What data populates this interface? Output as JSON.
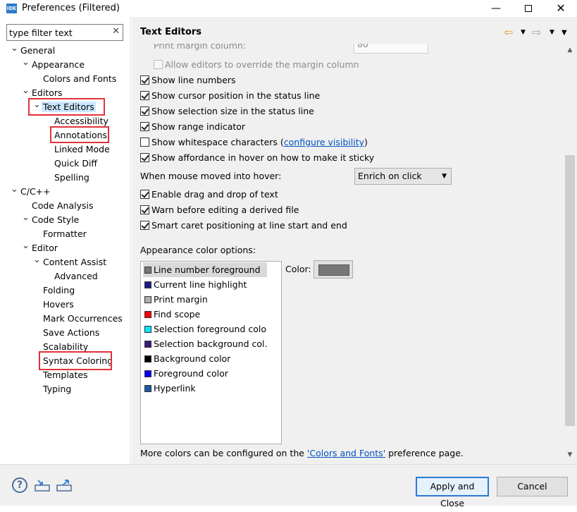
{
  "window": {
    "icon_text": "IDE",
    "title": "Preferences (Filtered)",
    "minimize": "—",
    "close": "✕"
  },
  "sidebar": {
    "filter_placeholder": "type filter text",
    "filter_value": "type filter text",
    "clear": "✕",
    "tree": [
      {
        "label": "General",
        "level": 0,
        "caret": "down"
      },
      {
        "label": "Appearance",
        "level": 1,
        "caret": "down"
      },
      {
        "label": "Colors and Fonts",
        "level": 2,
        "caret": "none"
      },
      {
        "label": "Editors",
        "level": 1,
        "caret": "down"
      },
      {
        "label": "Text Editors",
        "level": 2,
        "caret": "down",
        "selected": true
      },
      {
        "label": "Accessibility",
        "level": 3,
        "caret": "none"
      },
      {
        "label": "Annotations",
        "level": 3,
        "caret": "none"
      },
      {
        "label": "Linked Mode",
        "level": 3,
        "caret": "none"
      },
      {
        "label": "Quick Diff",
        "level": 3,
        "caret": "none"
      },
      {
        "label": "Spelling",
        "level": 3,
        "caret": "none"
      },
      {
        "label": "C/C++",
        "level": 0,
        "caret": "down"
      },
      {
        "label": "Code Analysis",
        "level": 1,
        "caret": "none"
      },
      {
        "label": "Code Style",
        "level": 1,
        "caret": "down"
      },
      {
        "label": "Formatter",
        "level": 2,
        "caret": "none"
      },
      {
        "label": "Editor",
        "level": 1,
        "caret": "down"
      },
      {
        "label": "Content Assist",
        "level": 2,
        "caret": "down"
      },
      {
        "label": "Advanced",
        "level": 3,
        "caret": "none"
      },
      {
        "label": "Folding",
        "level": 2,
        "caret": "none"
      },
      {
        "label": "Hovers",
        "level": 2,
        "caret": "none"
      },
      {
        "label": "Mark Occurrences",
        "level": 2,
        "caret": "none"
      },
      {
        "label": "Save Actions",
        "level": 2,
        "caret": "none"
      },
      {
        "label": "Scalability",
        "level": 2,
        "caret": "none"
      },
      {
        "label": "Syntax Coloring",
        "level": 2,
        "caret": "none"
      },
      {
        "label": "Templates",
        "level": 2,
        "caret": "none"
      },
      {
        "label": "Typing",
        "level": 2,
        "caret": "none"
      }
    ]
  },
  "page": {
    "title": "Text Editors",
    "cut_row": "Print margin column:",
    "cut_value": "80",
    "allow_override": "Allow editors to override the margin column",
    "options": [
      {
        "label": "Show line numbers",
        "checked": true
      },
      {
        "label": "Show cursor position in the status line",
        "checked": true
      },
      {
        "label": "Show selection size in the status line",
        "checked": true
      },
      {
        "label": "Show range indicator",
        "checked": true
      },
      {
        "label": "Show whitespace characters (",
        "checked": false,
        "link": "configure visibility",
        "suffix": ")"
      },
      {
        "label": "Show affordance in hover on how to make it sticky",
        "checked": true
      }
    ],
    "hover_label": "When mouse moved into hover:",
    "hover_value": "Enrich on click",
    "options2": [
      {
        "label": "Enable drag and drop of text",
        "checked": true
      },
      {
        "label": "Warn before editing a derived file",
        "checked": true
      },
      {
        "label": "Smart caret positioning at line start and end",
        "checked": true
      }
    ],
    "appearance_label": "Appearance color options:",
    "color_label": "Color:",
    "color_items": [
      {
        "label": "Line number foreground",
        "color": "#777777",
        "selected": true
      },
      {
        "label": "Current line highlight",
        "color": "#1a1a8c"
      },
      {
        "label": "Print margin",
        "color": "#b0b0b0"
      },
      {
        "label": "Find scope",
        "color": "#ff0000"
      },
      {
        "label": "Selection foreground color",
        "color": "#00e5ff"
      },
      {
        "label": "Selection background col…",
        "color": "#3a1a7a"
      },
      {
        "label": "Background color",
        "color": "#000000"
      },
      {
        "label": "Foreground color",
        "color": "#0000ff"
      },
      {
        "label": "Hyperlink",
        "color": "#1a5aa8"
      }
    ],
    "more_colors_prefix": "More colors can be configured on the ",
    "more_colors_link": "'Colors and Fonts'",
    "more_colors_suffix": " preference page."
  },
  "footer": {
    "help": "?",
    "apply_close": "Apply and Close",
    "cancel": "Cancel"
  },
  "colors": {
    "highlight_box": "#e0333a",
    "selection": "#cce8ff",
    "link": "#0050c0"
  }
}
